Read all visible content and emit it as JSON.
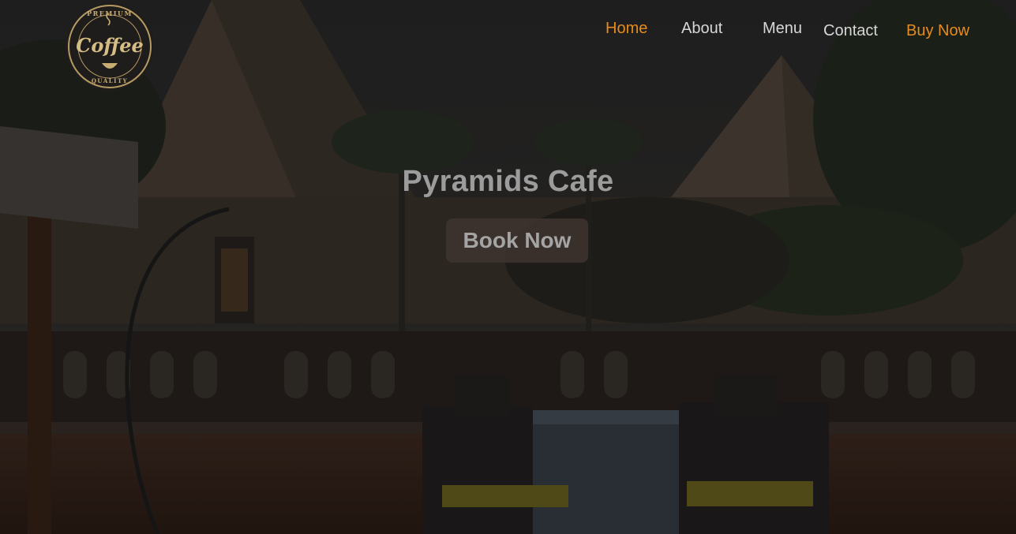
{
  "brand": {
    "logo_top_text": "PREMIUM",
    "logo_main_text": "Coffee",
    "logo_bottom_text": "QUALITY"
  },
  "nav": {
    "home": "Home",
    "about": "About",
    "menu": "Menu",
    "contact": "Contact",
    "buy": "Buy Now"
  },
  "hero": {
    "title": "Pyramids Cafe",
    "cta": "Book Now"
  },
  "colors": {
    "accent": "#e58b1f",
    "nav_text": "#d7d7d7"
  }
}
